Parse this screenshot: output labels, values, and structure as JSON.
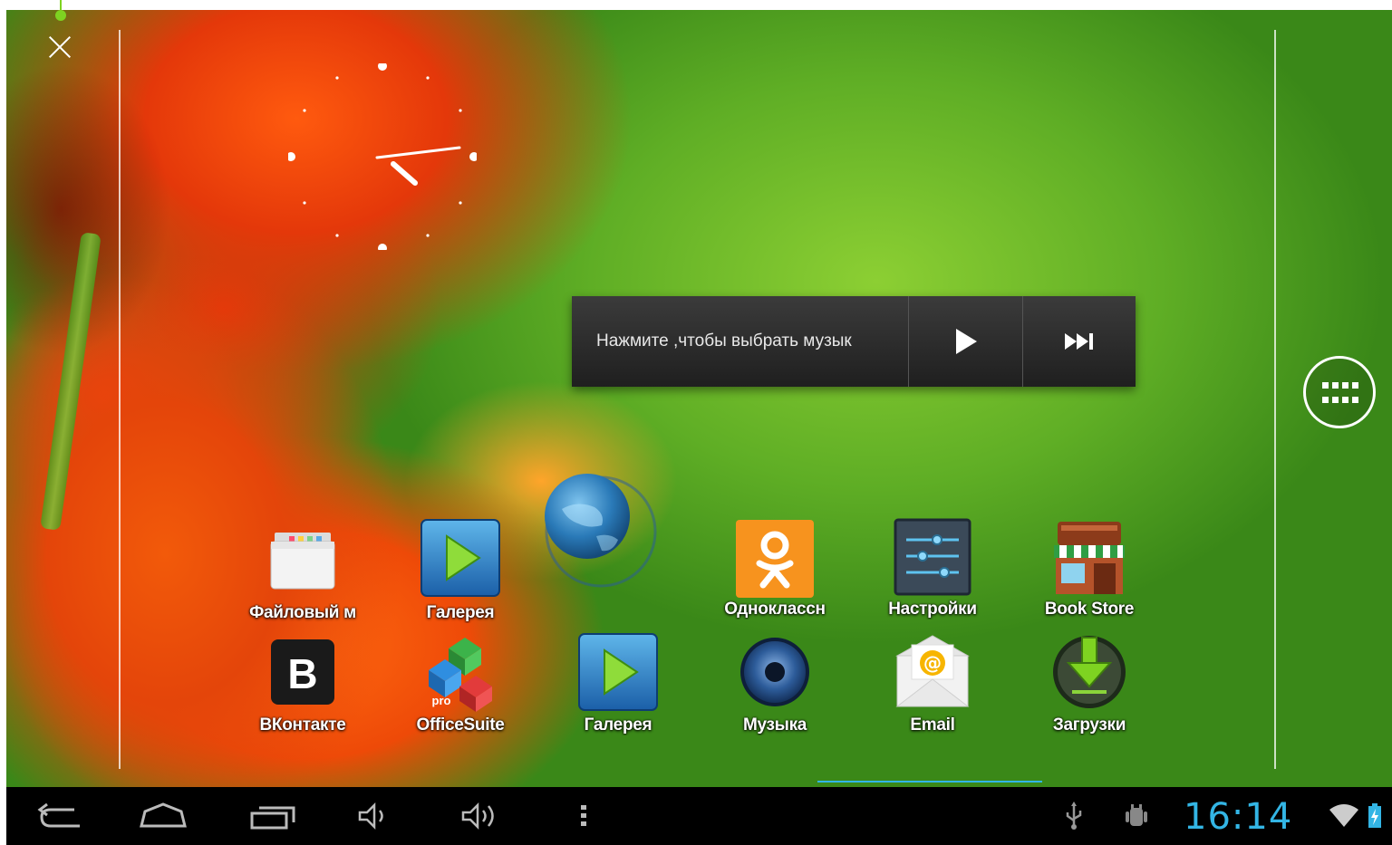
{
  "music_widget": {
    "prompt": "Нажмите ,чтобы выбрать музык",
    "play_icon": "play-icon",
    "next_icon": "skip-next-icon"
  },
  "apps": [
    {
      "label": "Файловый м",
      "icon": "folder-icon"
    },
    {
      "label": "Галерея",
      "icon": "gallery-play-icon"
    },
    {
      "label": "Одноклассн",
      "icon": "odnoklassniki-icon"
    },
    {
      "label": "Настройки",
      "icon": "settings-sliders-icon"
    },
    {
      "label": "Book Store",
      "icon": "bookstore-icon"
    },
    {
      "label": "ВКонтакте",
      "icon": "vk-icon"
    },
    {
      "label": "OfficeSuite",
      "icon": "officesuite-icon"
    },
    {
      "label": "Галерея",
      "icon": "gallery-play-icon"
    },
    {
      "label": "Музыка",
      "icon": "speaker-icon"
    },
    {
      "label": "Email",
      "icon": "email-icon"
    },
    {
      "label": "Загрузки",
      "icon": "download-icon"
    }
  ],
  "vk_letter": "B",
  "office_badge": "pro",
  "status_bar": {
    "time": "16:14",
    "icons": [
      "usb-icon",
      "android-debug-icon",
      "wifi-icon",
      "battery-charging-icon"
    ]
  },
  "nav_bar": {
    "icons": [
      "back-icon",
      "home-icon",
      "recent-apps-icon",
      "volume-down-icon",
      "volume-up-icon",
      "menu-icon"
    ]
  },
  "colors": {
    "accent": "#33b5e5",
    "navbar": "#000000",
    "widget_bg": "#2a2a2a"
  }
}
